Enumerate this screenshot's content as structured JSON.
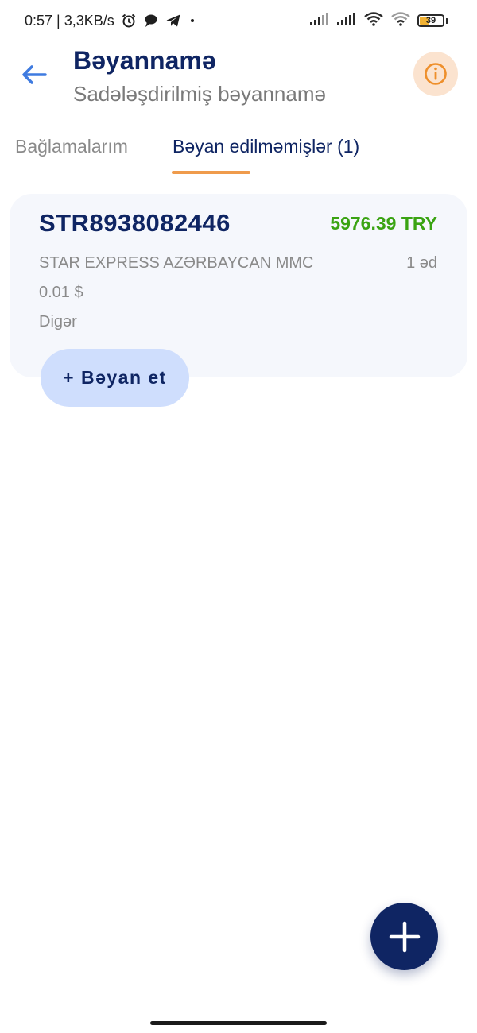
{
  "status_bar": {
    "time_speed": "0:57 | 3,3KB/s",
    "battery_level": "39",
    "icons": [
      "alarm-icon",
      "chat-bubble-icon",
      "telegram-icon",
      "dot-icon",
      "signal-icon",
      "signal-icon",
      "wifi-icon",
      "wifi-icon",
      "battery-icon"
    ]
  },
  "header": {
    "title": "Bəyannamə",
    "subtitle": "Sadələşdirilmiş bəyannamə",
    "back_icon": "arrow-left-icon",
    "info_icon": "info-icon"
  },
  "tabs": [
    {
      "label": "Bağlamalarım",
      "active": false
    },
    {
      "label": "Bəyan edilməmişlər (1)",
      "active": true
    }
  ],
  "package": {
    "tracking_number": "STR8938082446",
    "amount": "5976.39 TRY",
    "company": "STAR EXPRESS AZƏRBAYCAN MMC",
    "quantity": "1 əd",
    "price": "0.01 $",
    "category": "Digər",
    "declare_label": "+ Bəyan et"
  },
  "fab": {
    "icon": "plus-icon"
  },
  "colors": {
    "primary": "#0f2563",
    "accent_orange": "#ef9b4c",
    "amount_green": "#3aa312",
    "card_bg": "#f5f7fc",
    "declare_bg": "#cfdefd",
    "info_bg": "#fbe3cf",
    "back_arrow": "#3f7be0"
  }
}
